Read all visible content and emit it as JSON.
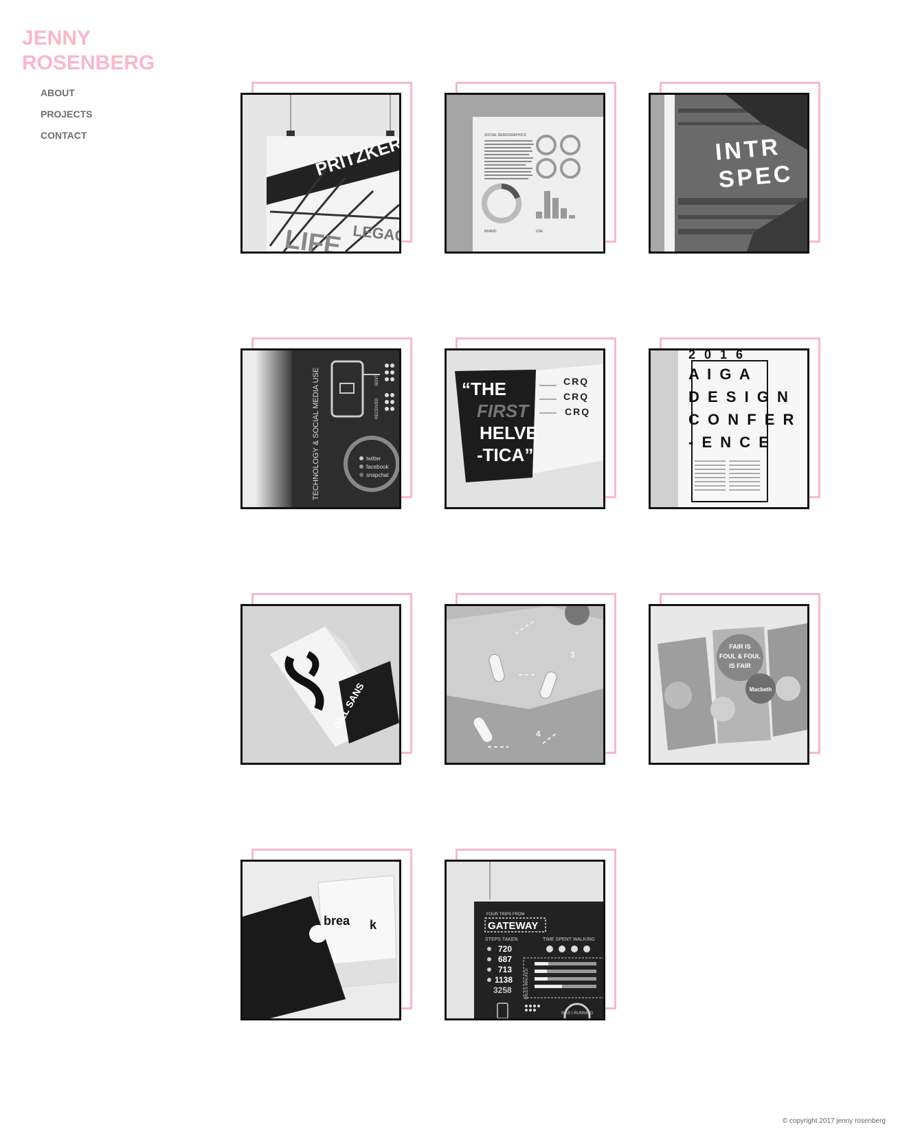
{
  "brand": {
    "line1": "JENNY",
    "line2": "ROSENBERG",
    "color": "#f9b8c9"
  },
  "nav": {
    "about": "ABOUT",
    "projects": "PROJECTS",
    "contact": "CONTACT"
  },
  "projects": [
    {
      "art": "poster-hanging",
      "texts": [
        "PRITZKER",
        "LIFE",
        "LEGACY"
      ]
    },
    {
      "art": "infographic-chart",
      "texts": [
        "SOCIAL DEMOGRAPHICS",
        "BRAND",
        "USE"
      ]
    },
    {
      "art": "dark-spec",
      "texts": [
        "INTR",
        "SPEC"
      ]
    },
    {
      "art": "social-media",
      "texts": [
        "TECHNOLOGY & SOCIAL MEDIA USE",
        "SENT",
        "RECEIVED",
        "twitter",
        "facebook",
        "snapchat"
      ]
    },
    {
      "art": "helvetica-book",
      "texts": [
        "“THE",
        "FIRST",
        "HELVE",
        "-TICA”",
        "CRQ",
        "CRQ",
        "CRQ"
      ]
    },
    {
      "art": "aiga-poster",
      "texts": [
        "2 0 1 6",
        "A I G A",
        "D E S I G N",
        "C O N F E R",
        "- E N C E"
      ]
    },
    {
      "art": "gill-sans",
      "texts": [
        "GILL SANS"
      ]
    },
    {
      "art": "folded-map",
      "texts": [
        "3",
        "4"
      ]
    },
    {
      "art": "macbeth-books",
      "texts": [
        "FAIR IS",
        "FOUL & FOUL",
        "IS FAIR",
        "Macbeth"
      ]
    },
    {
      "art": "break-book",
      "texts": [
        "brea",
        "k"
      ]
    },
    {
      "art": "gateway-poster",
      "texts": [
        "FOUR TRIPS FROM",
        "GATEWAY",
        "STEPS TAKEN",
        "720",
        "687",
        "713",
        "1138",
        "3258",
        "TIME SPENT WALKING",
        "MILES WALKED",
        "WAS I RUNNING"
      ]
    }
  ],
  "footer": {
    "copyright": "© copyright 2017 jenny rosenberg"
  }
}
